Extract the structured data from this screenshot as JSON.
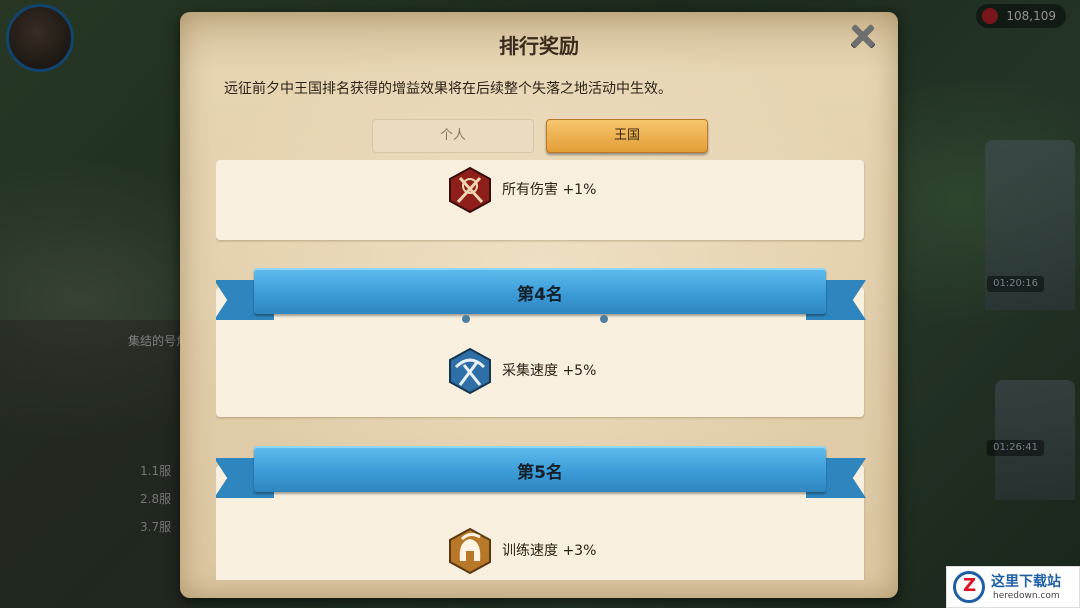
{
  "background": {
    "resource_value": "108,109",
    "timers": [
      "01:20:16",
      "01:26:41"
    ],
    "side_title": "集结的号角",
    "side_list": [
      "1.1服",
      "2.8服",
      "3.7服"
    ]
  },
  "dialog": {
    "title": "排行奖励",
    "description": "远征前夕中王国排名获得的增益效果将在后续整个失落之地活动中生效。",
    "tabs": [
      {
        "label": "个人",
        "selected": false
      },
      {
        "label": "王国",
        "selected": true
      }
    ],
    "rewards": [
      {
        "rank": "",
        "bonus": "所有伤害 +1%",
        "icon": "crossed-swords-icon",
        "color": "#8e1f1a"
      },
      {
        "rank": "第4名",
        "bonus": "采集速度 +5%",
        "icon": "pickaxe-shovel-icon",
        "color": "#2f6fa8"
      },
      {
        "rank": "第5名",
        "bonus": "训练速度 +3%",
        "icon": "spartan-helmet-icon",
        "color": "#b8782a"
      }
    ]
  },
  "watermark": {
    "title": "这里下载站",
    "domain": "heredown.com"
  }
}
